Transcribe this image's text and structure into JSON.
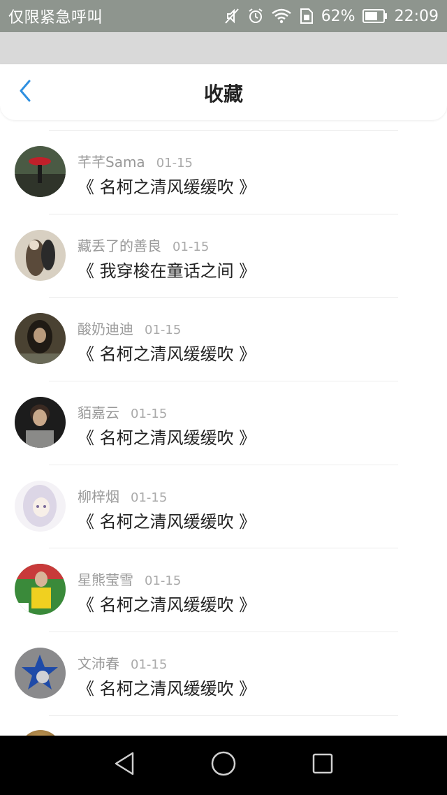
{
  "status_bar": {
    "carrier": "仅限紧急呼叫",
    "battery": "62%",
    "time": "22:09",
    "icons": [
      "mute-icon",
      "alarm-icon",
      "wifi-icon",
      "sim-icon",
      "battery-icon"
    ]
  },
  "header": {
    "title": "收藏",
    "back_icon": "chevron-left-icon"
  },
  "colors": {
    "accent": "#2e8fe0",
    "status_bar_bg": "#8e958e",
    "title": "#222222",
    "meta": "#999999"
  },
  "favorites": [
    {
      "user": "芊芊Sama",
      "date": "01-15",
      "title": "《 名柯之清风缓缓吹 》"
    },
    {
      "user": "藏丢了的善良",
      "date": "01-15",
      "title": "《 我穿梭在童话之间 》"
    },
    {
      "user": "酸奶迪迪",
      "date": "01-15",
      "title": "《 名柯之清风缓缓吹 》"
    },
    {
      "user": "貊嘉云",
      "date": "01-15",
      "title": "《 名柯之清风缓缓吹 》"
    },
    {
      "user": "柳梓烟",
      "date": "01-15",
      "title": "《 名柯之清风缓缓吹 》"
    },
    {
      "user": "星熊莹雪",
      "date": "01-15",
      "title": "《 名柯之清风缓缓吹 》"
    },
    {
      "user": "文沛春",
      "date": "01-15",
      "title": "《 名柯之清风缓缓吹 》"
    }
  ],
  "nav_bar": {
    "icons": [
      "back-triangle-icon",
      "home-circle-icon",
      "recents-square-icon"
    ]
  }
}
